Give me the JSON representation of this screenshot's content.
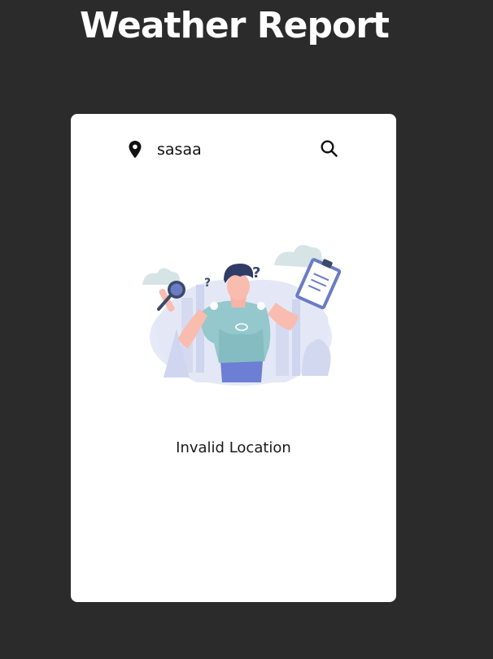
{
  "app": {
    "title": "Weather Report"
  },
  "search": {
    "location_icon": "map-pin-icon",
    "value": "sasaa",
    "search_icon": "search-icon"
  },
  "result": {
    "illustration": "confused-person-with-magnifier-and-clipboard",
    "message": "Invalid Location"
  },
  "colors": {
    "background": "#2b2b2b",
    "card": "#ffffff",
    "title_text": "#ffffff",
    "body_text": "#1a1a1a"
  }
}
